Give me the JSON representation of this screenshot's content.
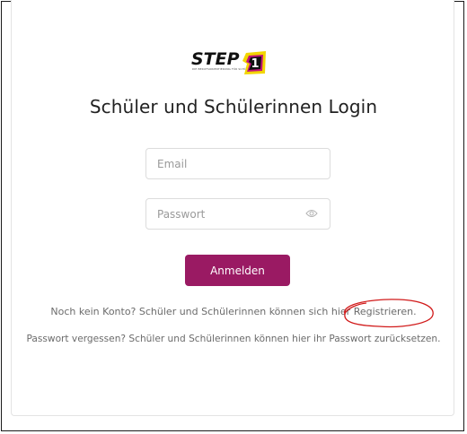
{
  "logo": {
    "text": "STEP",
    "badge_number": "1",
    "tagline": "DIE BERUFSORIENTIERUNG FÜR SCHÜLER"
  },
  "page_title": "Schüler und Schülerinnen Login",
  "form": {
    "email_placeholder": "Email",
    "password_placeholder": "Passwort",
    "submit_label": "Anmelden"
  },
  "register": {
    "prefix": "Noch kein Konto? Schüler und Schülerinnen können sich hier ",
    "link": "Registrieren."
  },
  "forgot": {
    "prefix": "Passwort vergessen? Schüler und Schülerinnen können hier ihr Passwort ",
    "link": "zurücksetzen."
  },
  "colors": {
    "accent": "#9a1a63",
    "logo_yellow": "#f2d500",
    "logo_magenta": "#c2127a",
    "annotation_red": "#d11a1a"
  },
  "icons": {
    "password_toggle": "eye-icon"
  }
}
